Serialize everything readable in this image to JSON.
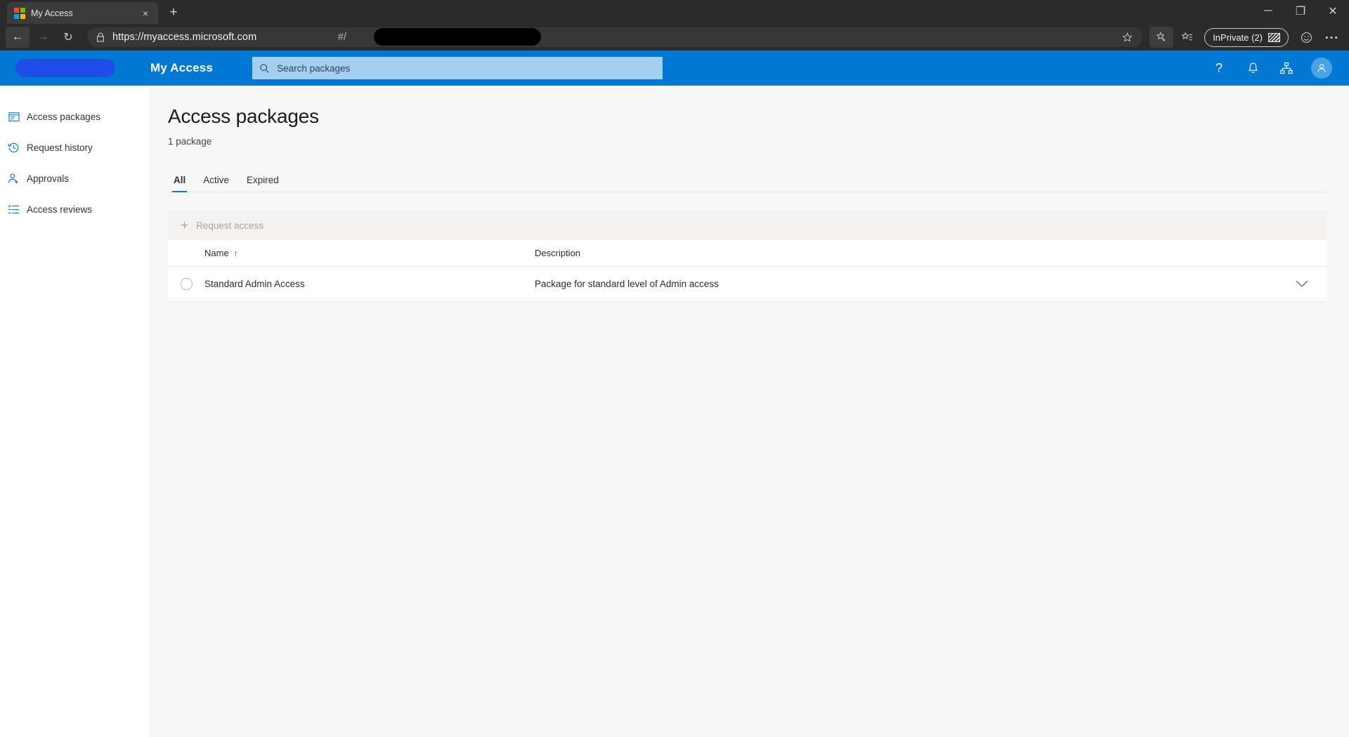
{
  "browser": {
    "tab": {
      "title": "My Access",
      "favicon": "microsoft-logo-icon",
      "close_label": "×"
    },
    "new_tab_label": "+",
    "window_controls": {
      "minimize": "─",
      "restore": "❐",
      "close": "✕"
    },
    "nav": {
      "back": "←",
      "forward": "→",
      "reload": "↻"
    },
    "address": {
      "lock_icon": "lock-icon",
      "url_visible": "https://myaccess.microsoft.com",
      "url_suffix": "#/",
      "redacted": true,
      "favorite_icon": "star-icon"
    },
    "toolbar": {
      "collections_icon": "collections-icon",
      "inprivate_label": "InPrivate (2)",
      "profile_icon": "smiley-icon",
      "settings_icon": "ellipsis-icon"
    }
  },
  "appbar": {
    "brand_redacted": true,
    "title": "My Access",
    "search": {
      "placeholder": "Search packages",
      "value": "",
      "icon": "search-icon"
    },
    "actions": [
      {
        "name": "help-icon",
        "glyph": "?"
      },
      {
        "name": "notifications-bell-icon",
        "glyph": "🔔"
      },
      {
        "name": "org-hierarchy-icon",
        "glyph": "⑂"
      },
      {
        "name": "account-avatar",
        "glyph": "👤"
      }
    ]
  },
  "sidebar": {
    "items": [
      {
        "label": "Access packages",
        "icon": "access-packages-icon"
      },
      {
        "label": "Request history",
        "icon": "history-clock-icon"
      },
      {
        "label": "Approvals",
        "icon": "person-add-icon"
      },
      {
        "label": "Access reviews",
        "icon": "checklist-icon"
      }
    ]
  },
  "main": {
    "title": "Access packages",
    "subtitle": "1 package",
    "tabs": [
      {
        "label": "All",
        "active": true
      },
      {
        "label": "Active",
        "active": false
      },
      {
        "label": "Expired",
        "active": false
      }
    ],
    "command_bar": {
      "request_access_label": "Request access",
      "plus": "+",
      "disabled": true
    },
    "table": {
      "columns": [
        "Name",
        "Description"
      ],
      "sort_column": "Name",
      "sort_direction": "↑",
      "rows": [
        {
          "selected": false,
          "name": "Standard Admin Access",
          "description": "Package for standard level of Admin access",
          "expand_icon": "chevron-down-icon"
        }
      ]
    }
  },
  "colors": {
    "accent": "#0078d4",
    "chrome": "#2b2b2b",
    "page_bg": "#f7f7f7"
  }
}
